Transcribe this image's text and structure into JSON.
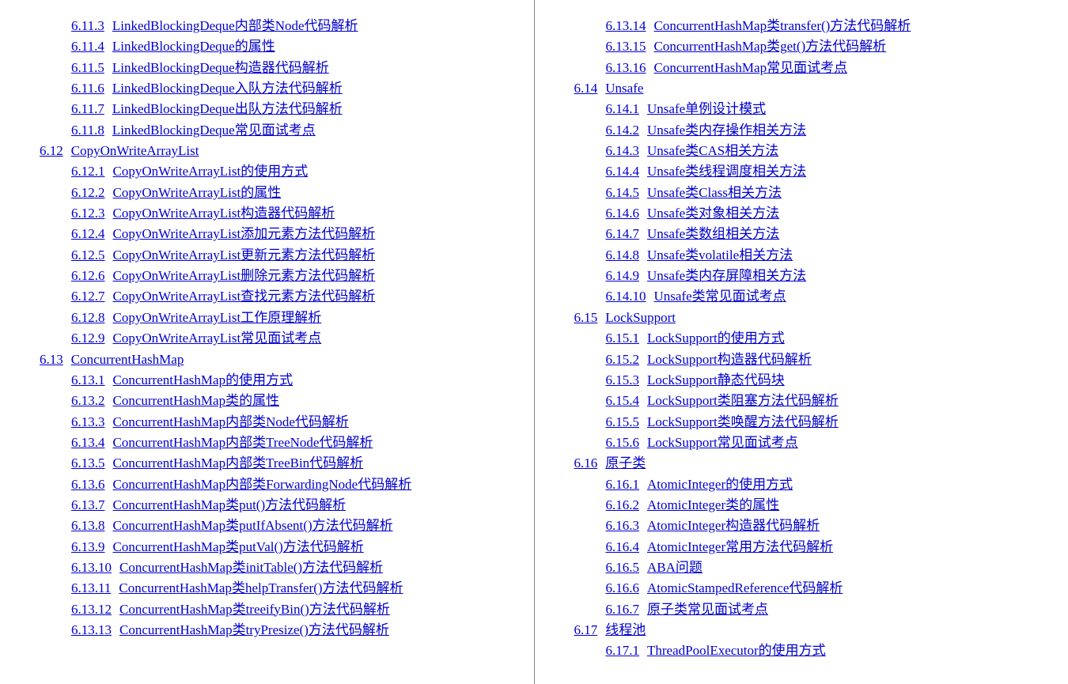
{
  "left_column": [
    {
      "level": 2,
      "num": "6.11.3",
      "text": "LinkedBlockingDeque内部类Node代码解析"
    },
    {
      "level": 2,
      "num": "6.11.4",
      "text": "LinkedBlockingDeque的属性"
    },
    {
      "level": 2,
      "num": "6.11.5",
      "text": "LinkedBlockingDeque构造器代码解析"
    },
    {
      "level": 2,
      "num": "6.11.6",
      "text": "LinkedBlockingDeque入队方法代码解析"
    },
    {
      "level": 2,
      "num": "6.11.7",
      "text": "LinkedBlockingDeque出队方法代码解析"
    },
    {
      "level": 2,
      "num": "6.11.8",
      "text": "LinkedBlockingDeque常见面试考点"
    },
    {
      "level": 1,
      "num": "6.12",
      "text": "CopyOnWriteArrayList"
    },
    {
      "level": 2,
      "num": "6.12.1",
      "text": "CopyOnWriteArrayList的使用方式"
    },
    {
      "level": 2,
      "num": "6.12.2",
      "text": "CopyOnWriteArrayList的属性"
    },
    {
      "level": 2,
      "num": "6.12.3",
      "text": "CopyOnWriteArrayList构造器代码解析"
    },
    {
      "level": 2,
      "num": "6.12.4",
      "text": "CopyOnWriteArrayList添加元素方法代码解析"
    },
    {
      "level": 2,
      "num": "6.12.5",
      "text": "CopyOnWriteArrayList更新元素方法代码解析"
    },
    {
      "level": 2,
      "num": "6.12.6",
      "text": "CopyOnWriteArrayList删除元素方法代码解析"
    },
    {
      "level": 2,
      "num": "6.12.7",
      "text": "CopyOnWriteArrayList查找元素方法代码解析"
    },
    {
      "level": 2,
      "num": "6.12.8",
      "text": "CopyOnWriteArrayList工作原理解析"
    },
    {
      "level": 2,
      "num": "6.12.9",
      "text": "CopyOnWriteArrayList常见面试考点"
    },
    {
      "level": 1,
      "num": "6.13",
      "text": "ConcurrentHashMap"
    },
    {
      "level": 2,
      "num": "6.13.1",
      "text": "ConcurrentHashMap的使用方式"
    },
    {
      "level": 2,
      "num": "6.13.2",
      "text": "ConcurrentHashMap类的属性"
    },
    {
      "level": 2,
      "num": "6.13.3",
      "text": "ConcurrentHashMap内部类Node代码解析"
    },
    {
      "level": 2,
      "num": "6.13.4",
      "text": "ConcurrentHashMap内部类TreeNode代码解析"
    },
    {
      "level": 2,
      "num": "6.13.5",
      "text": "ConcurrentHashMap内部类TreeBin代码解析"
    },
    {
      "level": 2,
      "num": "6.13.6",
      "text": "ConcurrentHashMap内部类ForwardingNode代码解析"
    },
    {
      "level": 2,
      "num": "6.13.7",
      "text": "ConcurrentHashMap类put()方法代码解析"
    },
    {
      "level": 2,
      "num": "6.13.8",
      "text": "ConcurrentHashMap类putIfAbsent()方法代码解析"
    },
    {
      "level": 2,
      "num": "6.13.9",
      "text": "ConcurrentHashMap类putVal()方法代码解析"
    },
    {
      "level": 2,
      "num": "6.13.10",
      "text": "ConcurrentHashMap类initTable()方法代码解析"
    },
    {
      "level": 2,
      "num": "6.13.11",
      "text": "ConcurrentHashMap类helpTransfer()方法代码解析"
    },
    {
      "level": 2,
      "num": "6.13.12",
      "text": "ConcurrentHashMap类treeifyBin()方法代码解析"
    },
    {
      "level": 2,
      "num": "6.13.13",
      "text": "ConcurrentHashMap类tryPresize()方法代码解析"
    }
  ],
  "right_column": [
    {
      "level": 2,
      "num": "6.13.14",
      "text": "ConcurrentHashMap类transfer()方法代码解析"
    },
    {
      "level": 2,
      "num": "6.13.15",
      "text": "ConcurrentHashMap类get()方法代码解析"
    },
    {
      "level": 2,
      "num": "6.13.16",
      "text": "ConcurrentHashMap常见面试考点"
    },
    {
      "level": 1,
      "num": "6.14",
      "text": "Unsafe"
    },
    {
      "level": 2,
      "num": "6.14.1",
      "text": "Unsafe单例设计模式"
    },
    {
      "level": 2,
      "num": "6.14.2",
      "text": "Unsafe类内存操作相关方法"
    },
    {
      "level": 2,
      "num": "6.14.3",
      "text": "Unsafe类CAS相关方法"
    },
    {
      "level": 2,
      "num": "6.14.4",
      "text": "Unsafe类线程调度相关方法"
    },
    {
      "level": 2,
      "num": "6.14.5",
      "text": "Unsafe类Class相关方法"
    },
    {
      "level": 2,
      "num": "6.14.6",
      "text": "Unsafe类对象相关方法"
    },
    {
      "level": 2,
      "num": "6.14.7",
      "text": "Unsafe类数组相关方法"
    },
    {
      "level": 2,
      "num": "6.14.8",
      "text": "Unsafe类volatile相关方法"
    },
    {
      "level": 2,
      "num": "6.14.9",
      "text": "Unsafe类内存屏障相关方法"
    },
    {
      "level": 2,
      "num": "6.14.10",
      "text": "Unsafe类常见面试考点"
    },
    {
      "level": 1,
      "num": "6.15",
      "text": "LockSupport"
    },
    {
      "level": 2,
      "num": "6.15.1",
      "text": "LockSupport的使用方式"
    },
    {
      "level": 2,
      "num": "6.15.2",
      "text": "LockSupport构造器代码解析"
    },
    {
      "level": 2,
      "num": "6.15.3",
      "text": "LockSupport静态代码块"
    },
    {
      "level": 2,
      "num": "6.15.4",
      "text": "LockSupport类阻塞方法代码解析"
    },
    {
      "level": 2,
      "num": "6.15.5",
      "text": "LockSupport类唤醒方法代码解析"
    },
    {
      "level": 2,
      "num": "6.15.6",
      "text": "LockSupport常见面试考点"
    },
    {
      "level": 1,
      "num": "6.16",
      "text": "原子类"
    },
    {
      "level": 2,
      "num": "6.16.1",
      "text": "AtomicInteger的使用方式"
    },
    {
      "level": 2,
      "num": "6.16.2",
      "text": "AtomicInteger类的属性"
    },
    {
      "level": 2,
      "num": "6.16.3",
      "text": "AtomicInteger构造器代码解析"
    },
    {
      "level": 2,
      "num": "6.16.4",
      "text": "AtomicInteger常用方法代码解析"
    },
    {
      "level": 2,
      "num": "6.16.5",
      "text": "ABA问题"
    },
    {
      "level": 2,
      "num": "6.16.6",
      "text": "AtomicStampedReference代码解析"
    },
    {
      "level": 2,
      "num": "6.16.7",
      "text": "原子类常见面试考点"
    },
    {
      "level": 1,
      "num": "6.17",
      "text": "线程池"
    },
    {
      "level": 2,
      "num": "6.17.1",
      "text": "ThreadPoolExecutor的使用方式"
    }
  ]
}
